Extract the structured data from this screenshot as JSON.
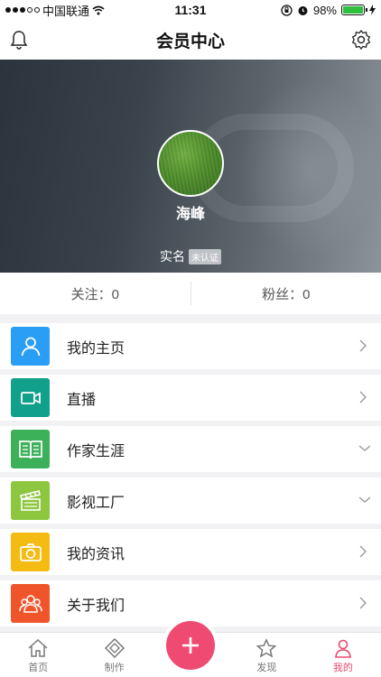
{
  "status_bar": {
    "carrier": "中国联通",
    "time": "11:31",
    "battery": "98%",
    "battery_level": 0.98
  },
  "nav": {
    "title": "会员中心",
    "left_icon": "bell-icon",
    "right_icon": "gear-icon"
  },
  "profile": {
    "username": "海峰",
    "realname_label": "实名",
    "verify_badge": "未认证"
  },
  "stats": {
    "following": "关注：0",
    "followers": "粉丝：0"
  },
  "menu": [
    {
      "label": "我的主页",
      "icon": "person-icon",
      "color": "#2a9df4",
      "arrow": "chevron-right"
    },
    {
      "label": "直播",
      "icon": "video-camera-icon",
      "color": "#11a08a",
      "arrow": "chevron-right"
    },
    {
      "label": "作家生涯",
      "icon": "book-icon",
      "color": "#3db05a",
      "arrow": "chevron-down"
    },
    {
      "label": "影视工厂",
      "icon": "clapperboard-icon",
      "color": "#8dc63f",
      "arrow": "chevron-down"
    },
    {
      "label": "我的资讯",
      "icon": "camera-icon",
      "color": "#f4bb12",
      "arrow": "chevron-right"
    },
    {
      "label": "关于我们",
      "icon": "group-icon",
      "color": "#f0542a",
      "arrow": "chevron-right"
    }
  ],
  "tabbar": {
    "tabs": [
      {
        "label": "首页",
        "icon": "home-icon"
      },
      {
        "label": "制作",
        "icon": "create-icon"
      },
      {
        "label": "发现",
        "icon": "star-icon"
      },
      {
        "label": "我的",
        "icon": "person-icon"
      }
    ],
    "active_index": 3,
    "accent": "#e94b6e",
    "fab_icon": "plus-icon"
  }
}
